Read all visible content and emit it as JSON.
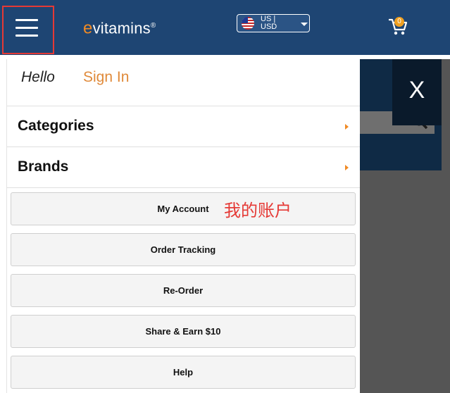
{
  "header": {
    "logo_e": "e",
    "logo_rest": "vitamins",
    "logo_reg": "®",
    "region_line1": "US |",
    "region_line2": "USD",
    "cart_count": "0",
    "close_label": "X"
  },
  "menu": {
    "hello": "Hello",
    "sign_in": "Sign In",
    "categories": "Categories",
    "brands": "Brands",
    "buttons": [
      {
        "label": "My Account"
      },
      {
        "label": "Order Tracking"
      },
      {
        "label": "Re-Order"
      },
      {
        "label": "Share & Earn $10"
      },
      {
        "label": "Help"
      }
    ]
  },
  "annotation": {
    "text": "我的账户",
    "color": "#e53935"
  },
  "colors": {
    "header_bg": "#1e4573",
    "accent_orange": "#f08a24",
    "highlight_red": "#e53935"
  },
  "icons": [
    "menu-icon",
    "flag-icon",
    "chevron-down-icon",
    "cart-icon",
    "search-icon",
    "close-icon",
    "chevron-right-icon"
  ]
}
